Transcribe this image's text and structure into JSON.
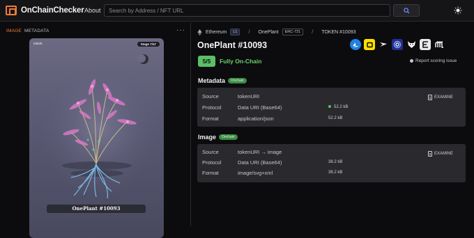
{
  "header": {
    "brand": "OnChainChecker",
    "about": "About",
    "search_placeholder": "Search by Address / NFT URL"
  },
  "left": {
    "tabs": [
      "IMAGE",
      "METADATA"
    ],
    "more": "···",
    "card": {
      "top_left": "6d6d6",
      "stage": "Stage 7/47",
      "title": "OnePlant #10093"
    }
  },
  "breadcrumb": {
    "chain": "Ethereum",
    "layer": "L1",
    "collection": "OnePlant",
    "standard": "ERC-721",
    "token": "TOKEN #10093",
    "separator": "/"
  },
  "nft_name": "OnePlant #10093",
  "marketplaces": [
    "opensea-icon",
    "rarible-icon",
    "looksrare-icon",
    "x2y2-icon",
    "blur-fox-icon",
    "etherscan-icon",
    "magiceden-icon"
  ],
  "score": {
    "value": "5/5",
    "label": "Fully On-Chain",
    "report": "Report scoring issue"
  },
  "metadata": {
    "title": "Metadata",
    "badge": "Onchain",
    "examine": "EXAMINE",
    "rows": [
      {
        "label": "Source",
        "value": "tokenURI",
        "size": ""
      },
      {
        "label": "Protocol",
        "value": "Data URI (Base64)",
        "size": "52.2 kB"
      },
      {
        "label": "Format",
        "value": "application/json",
        "size": "52.2 kB"
      }
    ]
  },
  "image": {
    "title": "Image",
    "badge": "Onchain",
    "examine": "EXAMINE",
    "rows": [
      {
        "label": "Source",
        "value": "tokenURI → image",
        "size": ""
      },
      {
        "label": "Protocol",
        "value": "Data URI (Base64)",
        "size": "38.2 kB"
      },
      {
        "label": "Format",
        "value": "image/svg+xml",
        "size": "38.2 kB"
      }
    ]
  },
  "colors": {
    "accent": "#f07a3a",
    "success": "#5cbf67",
    "panel": "#2a2a2e"
  }
}
